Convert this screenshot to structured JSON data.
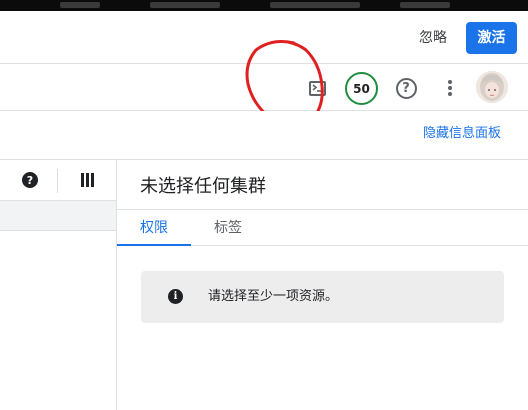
{
  "promo": {
    "dismiss_label": "忽略",
    "activate_label": "激活"
  },
  "header": {
    "cloud_shell_icon": "terminal-icon",
    "score_badge": "50",
    "help_label": "?",
    "more_icon": "more-vert-icon",
    "avatar_icon": "user-avatar"
  },
  "info_panel_toggle": {
    "label": "隐藏信息面板"
  },
  "left_toolbar": {
    "help_icon": "question-circle-icon",
    "columns_icon": "column-display-icon",
    "help_glyph": "?"
  },
  "detail_panel": {
    "title": "未选择任何集群",
    "tabs": [
      {
        "label": "权限",
        "active": true
      },
      {
        "label": "标签",
        "active": false
      }
    ],
    "info_icon_glyph": "i",
    "info_message": "请选择至少一项资源。"
  },
  "colors": {
    "accent": "#1a73e8",
    "score_ring": "#1e8e3e",
    "annotation": "#e02020",
    "info_box_bg": "#ededed"
  }
}
